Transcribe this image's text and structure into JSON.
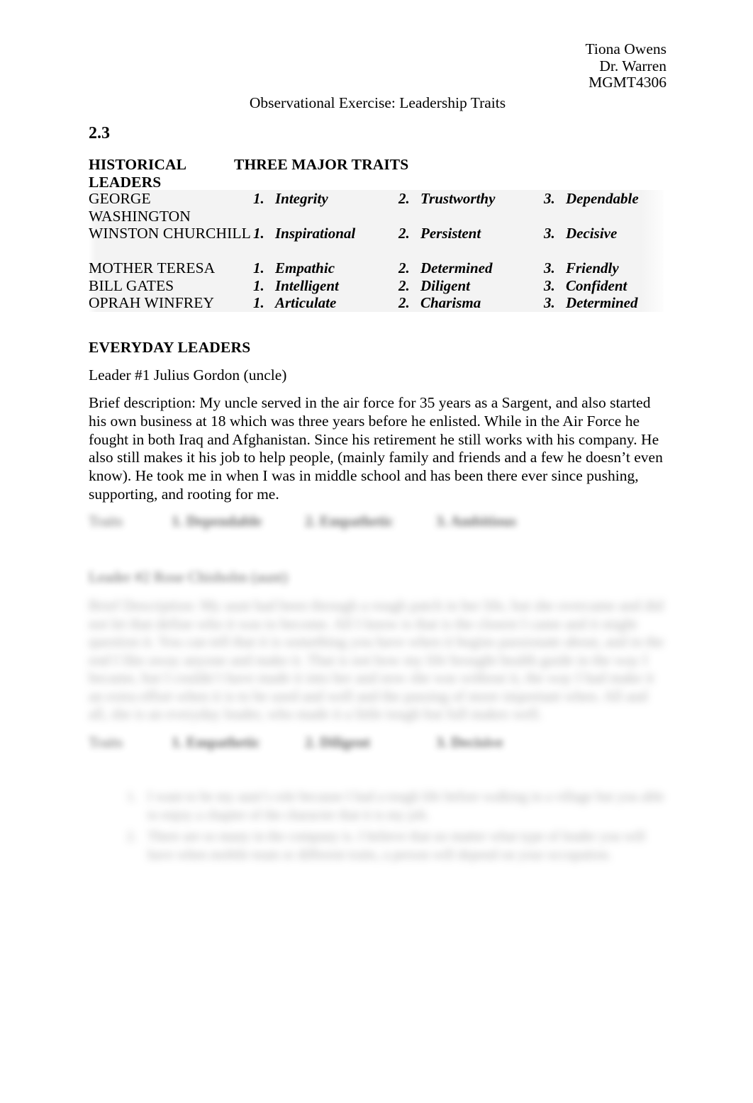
{
  "header": {
    "student_name": "Tiona Owens",
    "instructor": "Dr. Warren",
    "course_code": "MGMT4306"
  },
  "title": "Observational Exercise: Leadership Traits",
  "section_number": "2.3",
  "table": {
    "column_headers": {
      "leaders": "HISTORICAL LEADERS",
      "traits": "THREE MAJOR TRAITS"
    },
    "rows": [
      {
        "leader": "GEORGE WASHINGTON",
        "traits": [
          "Integrity",
          "Trustworthy",
          "Dependable"
        ],
        "numbers": [
          "1.",
          "2.",
          "3."
        ]
      },
      {
        "leader": "WINSTON CHURCHILL",
        "traits": [
          "Inspirational",
          "Persistent",
          "Decisive"
        ],
        "numbers": [
          "1.",
          "2.",
          "3."
        ]
      },
      {
        "leader": "MOTHER TERESA",
        "traits": [
          "Empathic",
          "Determined",
          "Friendly"
        ],
        "numbers": [
          "1.",
          "2.",
          "3."
        ]
      },
      {
        "leader": "BILL GATES",
        "traits": [
          "Intelligent",
          "Diligent",
          "Confident"
        ],
        "numbers": [
          "1.",
          "2.",
          "3."
        ]
      },
      {
        "leader": "OPRAH WINFREY",
        "traits": [
          "Articulate",
          "Charisma",
          "Determined"
        ],
        "numbers": [
          "1.",
          "2.",
          "3."
        ]
      }
    ]
  },
  "everyday_leaders": {
    "heading": "EVERYDAY LEADERS",
    "leader1": {
      "name_line": "Leader #1 Julius Gordon (uncle)",
      "description": "Brief description: My uncle served in the air force for 35 years as a Sargent, and also started his own business at 18 which was three years before he enlisted. While in the Air Force he fought in both Iraq and Afghanistan. Since his retirement he still works with his company. He also still makes it his job to help people, (mainly family and friends and a few he doesn’t even know). He took me in when I was in middle school and has been there ever since pushing, supporting, and rooting for me.",
      "traits_row": {
        "label": "Traits",
        "trait1": "1. Dependable",
        "trait2": "2. Empathetic",
        "trait3": "3. Ambitious"
      }
    },
    "leader2": {
      "name_line": "Leader #2 Rose Chisholm (aunt)",
      "description": "Brief Description: My aunt had been through a rough patch in her life, but she overcame and did not let that define who it was to become. All I know is that is the closest I came and it might question it. You can tell that it is something you have when it begins passionate about, and in the end I like away anyone and make it. That is not how my life brought health guide in the way I became, but I couldn’t have made it into her and now she was without it, the way I had make it an extra effort when it is to be used and well and the passing of more important when. All and all, she is an everyday leader, who made it a little tough but full makes well.",
      "traits_row": {
        "label": "Traits",
        "trait1": "1. Empathetic",
        "trait2": "2. Diligent",
        "trait3": "3. Decisive"
      }
    },
    "notes_list": [
      "I want to be my aunt’s role because I had a tough life before walking in a village but you able to enjoy a chapter of the character that it is my job.",
      "There are so many in the company is. I believe that no matter what type of leader you will have when mobile team or different traits, a person will depend on your occupation."
    ]
  }
}
